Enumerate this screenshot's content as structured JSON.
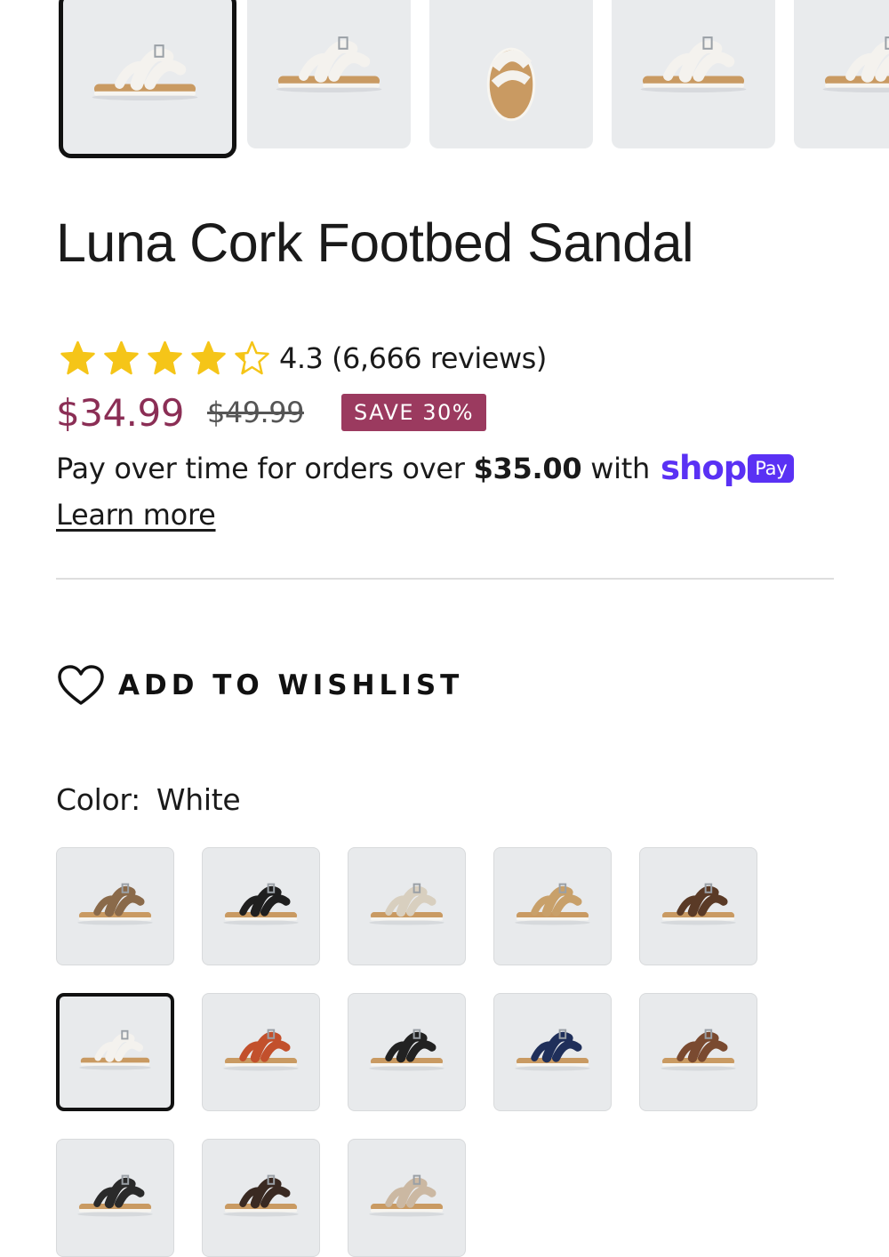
{
  "product": {
    "title": "Luna Cork Footbed Sandal",
    "rating_value": 4.3,
    "rating_text": "4.3 (6,666 reviews)",
    "price": "$34.99",
    "compare_price": "$49.99",
    "save_badge": "SAVE 30%"
  },
  "payment": {
    "prefix": "Pay over time for orders over",
    "threshold": "$35.00",
    "with_text": "with",
    "shop_word": "shop",
    "pay_word": "Pay",
    "learn_more": "Learn more"
  },
  "wishlist": {
    "label": "ADD TO WISHLIST",
    "icon": "heart-icon"
  },
  "color": {
    "label": "Color:",
    "selected": "White"
  },
  "colors": {
    "accent_price": "#8b2e55",
    "badge_bg": "#9b3a5f",
    "star": "#f5c518",
    "shop_pay": "#5a31f4"
  },
  "gallery": [
    {
      "strap": "#f4f2ee",
      "view": "side",
      "selected": true
    },
    {
      "strap": "#f4f2ee",
      "view": "angle",
      "selected": false
    },
    {
      "strap": "#f4f2ee",
      "view": "front",
      "selected": false
    },
    {
      "strap": "#f4f2ee",
      "view": "back",
      "selected": false
    },
    {
      "strap": "#f4f2ee",
      "view": "angle",
      "selected": false
    }
  ],
  "swatches": [
    {
      "strap": "#8a6a4a",
      "selected": false
    },
    {
      "strap": "#1f1f1f",
      "selected": false
    },
    {
      "strap": "#d8cfbf",
      "selected": false
    },
    {
      "strap": "#c8a06a",
      "selected": false
    },
    {
      "strap": "#5a3a26",
      "selected": false
    },
    {
      "strap": "#f4f2ee",
      "selected": true
    },
    {
      "strap": "#c2502c",
      "selected": false
    },
    {
      "strap": "#222222",
      "selected": false
    },
    {
      "strap": "#1f2f5a",
      "selected": false
    },
    {
      "strap": "#7a4a30",
      "selected": false
    },
    {
      "strap": "#2a2a2a",
      "selected": false
    },
    {
      "strap": "#3a2a22",
      "selected": false
    },
    {
      "strap": "#cbb8a2",
      "selected": false
    }
  ]
}
